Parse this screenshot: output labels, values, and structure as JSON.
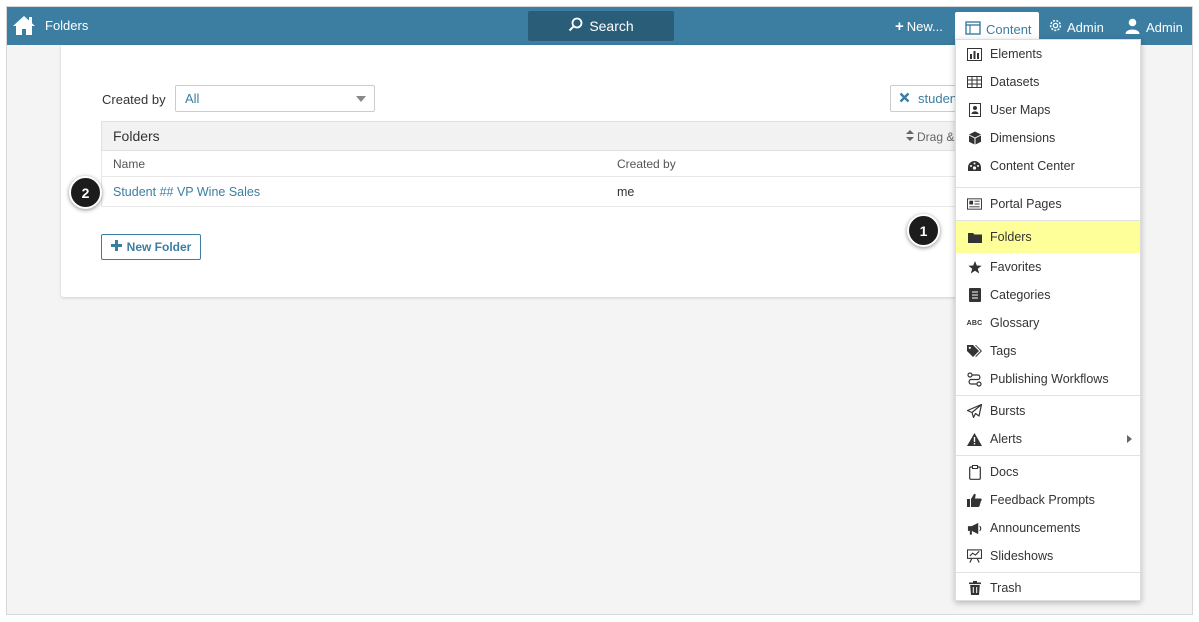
{
  "navbar": {
    "title": "Folders",
    "search_label": "Search",
    "new_label": "New...",
    "content_label": "Content",
    "admin_gear_label": "Admin",
    "admin_user_label": "Admin",
    "bg_color": "#3b7ea1"
  },
  "filter": {
    "label": "Created by",
    "selected": "All",
    "chip_label": "student"
  },
  "table": {
    "title": "Folders",
    "drag_hint": "Drag &",
    "columns": [
      "Name",
      "Created by"
    ],
    "rows": [
      {
        "name": "Student ## VP Wine Sales",
        "created_by": "me"
      }
    ]
  },
  "new_folder_label": "New Folder",
  "callouts": [
    "1",
    "2"
  ],
  "menu": {
    "items": [
      {
        "label": "Elements",
        "icon": "bar-chart-icon"
      },
      {
        "label": "Datasets",
        "icon": "table-icon"
      },
      {
        "label": "User Maps",
        "icon": "user-card-icon"
      },
      {
        "label": "Dimensions",
        "icon": "cube-icon"
      },
      {
        "label": "Content Center",
        "icon": "dashboard-icon"
      },
      {
        "label": "Portal Pages",
        "icon": "newspaper-icon"
      },
      {
        "label": "Folders",
        "icon": "folder-icon",
        "highlighted": true
      },
      {
        "label": "Favorites",
        "icon": "star-icon"
      },
      {
        "label": "Categories",
        "icon": "book-icon"
      },
      {
        "label": "Glossary",
        "icon": "abc-icon"
      },
      {
        "label": "Tags",
        "icon": "tags-icon"
      },
      {
        "label": "Publishing Workflows",
        "icon": "workflow-icon"
      },
      {
        "label": "Bursts",
        "icon": "paper-plane-icon"
      },
      {
        "label": "Alerts",
        "icon": "warning-icon"
      },
      {
        "label": "Docs",
        "icon": "clipboard-icon"
      },
      {
        "label": "Feedback Prompts",
        "icon": "thumbs-up-icon"
      },
      {
        "label": "Announcements",
        "icon": "bullhorn-icon"
      },
      {
        "label": "Slideshows",
        "icon": "presentation-icon"
      },
      {
        "label": "Trash",
        "icon": "trash-icon"
      }
    ]
  }
}
